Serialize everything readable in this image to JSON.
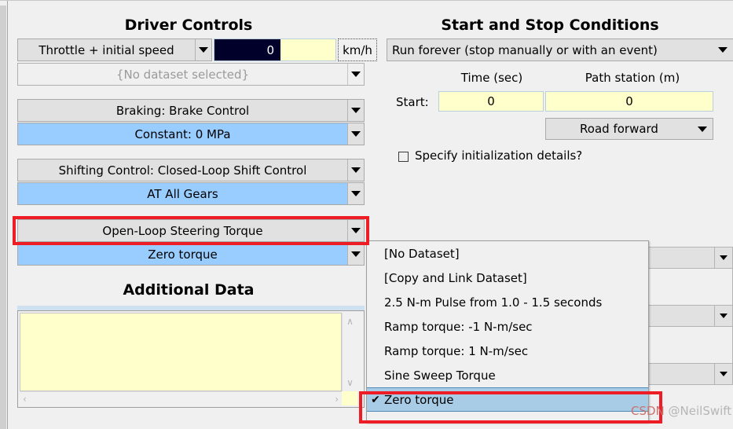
{
  "window": {
    "background": "#f0f0f0",
    "accent_blue": "#99ccff",
    "menu_select_blue": "#a8cce6",
    "highlight_red": "#ee1c25",
    "field_yellow": "#ffffcc"
  },
  "left_panel": {
    "title": "Driver Controls",
    "throttle_row": {
      "mode_label": "Throttle + initial speed",
      "speed_value": "0",
      "unit": "km/h"
    },
    "dataset_row": {
      "label": "{No dataset selected}"
    },
    "braking_row": {
      "label": "Braking: Brake Control",
      "value": "Constant: 0 MPa"
    },
    "shifting_row": {
      "label": "Shifting Control: Closed-Loop Shift Control",
      "value": "AT All Gears"
    },
    "steering_row": {
      "label": "Open-Loop Steering Torque",
      "value": "Zero torque"
    },
    "additional_data": {
      "title": "Additional Data",
      "text": "",
      "scroll_up": "∧",
      "scroll_down": "∨",
      "scroll_left": "‹",
      "scroll_right": "›"
    }
  },
  "right_panel": {
    "title": "Start and Stop Conditions",
    "run_mode": "Run forever (stop manually or with an event)",
    "column_headers": {
      "time": "Time (sec)",
      "path_station": "Path station (m)"
    },
    "start_row": {
      "label": "Start:",
      "time_value": "0",
      "station_value": "0"
    },
    "direction": "Road forward",
    "init_checkbox": {
      "label": "Specify initialization details?",
      "checked": false
    }
  },
  "dropdown_menu": {
    "items": [
      {
        "label": "[No Dataset]",
        "checked": false
      },
      {
        "label": "[Copy and Link Dataset]",
        "checked": false
      },
      {
        "label": "2.5 N-m Pulse from 1.0 - 1.5 seconds",
        "checked": false
      },
      {
        "label": "Ramp torque: -1 N-m/sec",
        "checked": false
      },
      {
        "label": "Ramp torque: 1 N-m/sec",
        "checked": false
      },
      {
        "label": "Sine Sweep Torque",
        "checked": false
      },
      {
        "label": "Zero torque",
        "checked": true
      }
    ],
    "check_glyph": "✔"
  },
  "watermark": {
    "prefix": "CSDN",
    "suffix": " @NeilSwift"
  },
  "icons": {
    "chevron_down": "▼"
  }
}
